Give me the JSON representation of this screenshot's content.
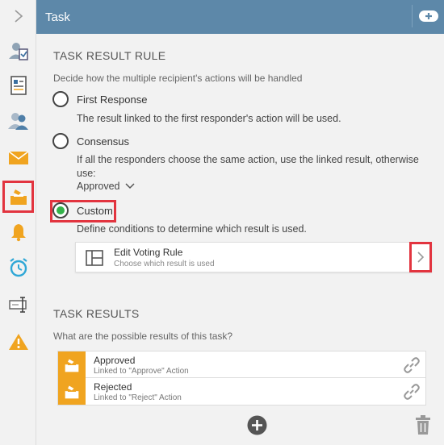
{
  "header": {
    "title": "Task"
  },
  "sidebar": {
    "items": [
      {
        "name": "expand-icon"
      },
      {
        "name": "assign-user-icon"
      },
      {
        "name": "form-icon"
      },
      {
        "name": "users-icon"
      },
      {
        "name": "email-icon"
      },
      {
        "name": "task-result-icon",
        "active": true
      },
      {
        "name": "notification-bell-icon"
      },
      {
        "name": "alarm-clock-icon"
      },
      {
        "name": "text-field-icon"
      },
      {
        "name": "warning-icon"
      }
    ]
  },
  "rule": {
    "title": "TASK RESULT RULE",
    "description": "Decide how the multiple recipient's actions will be handled",
    "options": [
      {
        "label": "First Response",
        "text": "The result linked to the first responder's action will be used.",
        "selected": false
      },
      {
        "label": "Consensus",
        "text": "If all the responders choose the same action, use the linked result, otherwise use:",
        "selected": false
      },
      {
        "label": "Custom",
        "text": "Define conditions to determine which result is used.",
        "selected": true
      }
    ],
    "consensus_value": "Approved"
  },
  "voting": {
    "title": "Edit Voting Rule",
    "subtitle": "Choose which result is used"
  },
  "results": {
    "title": "TASK RESULTS",
    "description": "What are the possible results of this task?",
    "items": [
      {
        "title": "Approved",
        "subtitle": "Linked to \"Approve\" Action"
      },
      {
        "title": "Rejected",
        "subtitle": "Linked to \"Reject\" Action"
      }
    ]
  },
  "colors": {
    "header": "#5d88a9",
    "accent": "#f0a420",
    "selected": "#33b24a",
    "highlight": "#e2343f"
  }
}
